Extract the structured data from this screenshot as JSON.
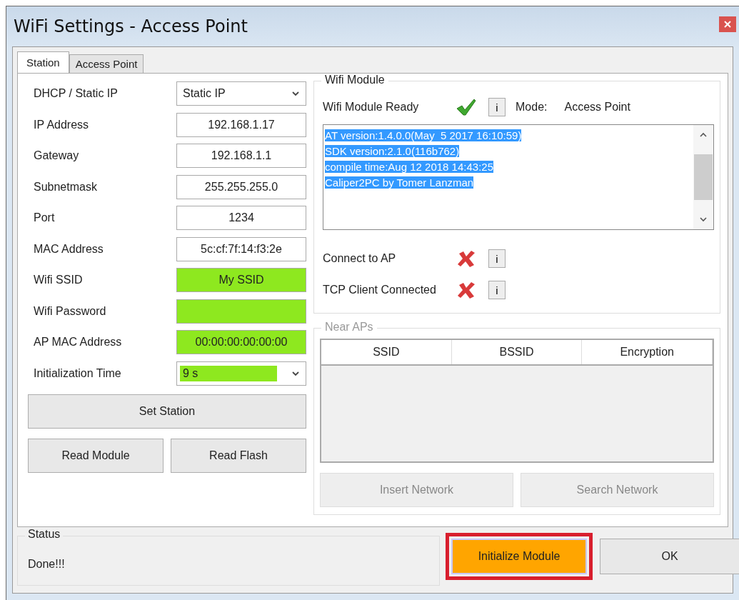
{
  "window": {
    "title": "WiFi Settings - Access Point"
  },
  "tabs": [
    {
      "label": "Station",
      "selected": true
    },
    {
      "label": "Access Point",
      "selected": false
    }
  ],
  "fields": [
    {
      "label": "DHCP / Static IP",
      "kind": "dropdown",
      "value": "Static IP",
      "highlighted": false
    },
    {
      "label": "IP Address",
      "kind": "text",
      "value": "192.168.1.17",
      "highlighted": false
    },
    {
      "label": "Gateway",
      "kind": "text",
      "value": "192.168.1.1",
      "highlighted": false
    },
    {
      "label": "Subnetmask",
      "kind": "text",
      "value": "255.255.255.0",
      "highlighted": false
    },
    {
      "label": "Port",
      "kind": "text",
      "value": "1234",
      "highlighted": false
    },
    {
      "label": "MAC Address",
      "kind": "text",
      "value": "5c:cf:7f:14:f3:2e",
      "highlighted": false
    },
    {
      "label": "Wifi SSID",
      "kind": "text",
      "value": "My SSID",
      "highlighted": true
    },
    {
      "label": "Wifi Password",
      "kind": "text",
      "highlighted": true
    },
    {
      "label": "AP MAC Address",
      "kind": "text",
      "value": "00:00:00:00:00:00",
      "highlighted": true
    },
    {
      "label": "Initialization Time",
      "kind": "dropdown",
      "value": "9 s",
      "highlighted": true
    }
  ],
  "set_station_button": "Set Station",
  "left_buttons": [
    "Read Module",
    "Read Flash"
  ],
  "wifi_module": {
    "title": "Wifi Module",
    "ready_label": "Wifi Module Ready",
    "ready_ok": true,
    "info_button": "i",
    "mode_label": "Mode:",
    "mode_value": "Access Point",
    "log": {
      "selected": true,
      "lines": [
        "AT version:1.4.0.0(May  5 2017 16:10:59)",
        "SDK version:2.1.0(116b762)",
        "compile time:Aug 12 2018 14:43:25",
        "Caliper2PC by Tomer Lanzman"
      ]
    },
    "checks": [
      {
        "label": "Connect to AP",
        "ok": false,
        "info_button": "i"
      },
      {
        "label": "TCP Client Connected",
        "ok": false,
        "info_button": "i"
      }
    ]
  },
  "near_aps": {
    "title": "Near APs",
    "disabled": true,
    "columns": [
      "SSID",
      "BSSID",
      "Encryption"
    ],
    "buttons": [
      {
        "label": "Insert Network",
        "disabled": true
      },
      {
        "label": "Search Network",
        "disabled": true
      }
    ]
  },
  "status": {
    "title": "Status",
    "text": "Done!!!"
  },
  "footer_buttons": [
    {
      "label": "Initialize Module",
      "kind": "accent",
      "highlighted": true
    },
    {
      "label": "OK",
      "kind": "normal",
      "highlighted": false
    }
  ]
}
